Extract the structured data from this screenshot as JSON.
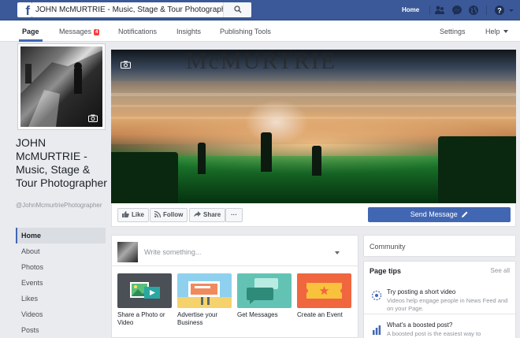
{
  "topbar": {
    "search_value": "JOHN McMURTRIE - Music, Stage & Tour Photographer",
    "home_label": "Home",
    "icons": [
      "friends-icon",
      "messenger-icon",
      "globe-icon",
      "help-icon",
      "caret-icon"
    ]
  },
  "pagenav": {
    "page": "Page",
    "messages": "Messages",
    "messages_badge": "4",
    "notifications": "Notifications",
    "insights": "Insights",
    "publishing_tools": "Publishing Tools",
    "settings": "Settings",
    "help": "Help"
  },
  "profile": {
    "name": "JOHN McMURTRIE - Music, Stage & Tour Photographer",
    "handle": "@JohnMcmurtriePhotographer"
  },
  "sidenav": {
    "items": [
      "Home",
      "About",
      "Photos",
      "Events",
      "Likes",
      "Videos",
      "Posts"
    ]
  },
  "cover": {
    "watermark": "McMURTRIE"
  },
  "actions": {
    "like": "Like",
    "follow": "Follow",
    "share": "Share",
    "more": "···",
    "send_message": "Send Message"
  },
  "composer": {
    "placeholder": "Write something...",
    "cards": [
      {
        "label": "Share a Photo or Video",
        "color": "#4b4f56"
      },
      {
        "label": "Advertise your Business",
        "color": "#8ed0ee"
      },
      {
        "label": "Get Messages",
        "color": "#62c3b4"
      },
      {
        "label": "Create an Event",
        "color": "#f0673f"
      }
    ]
  },
  "right": {
    "community": "Community",
    "tips_title": "Page tips",
    "see_all": "See all",
    "tips": [
      {
        "title": "Try posting a short video",
        "desc": "Videos help engage people in News Feed and on your Page."
      },
      {
        "title": "What's a boosted post?",
        "desc": "A boosted post is the easiest way to"
      }
    ]
  },
  "colors": {
    "brand_blue": "#3b5998",
    "button_blue": "#4267b2",
    "badge_red": "#fa3e3e",
    "background": "#e9ebee"
  }
}
